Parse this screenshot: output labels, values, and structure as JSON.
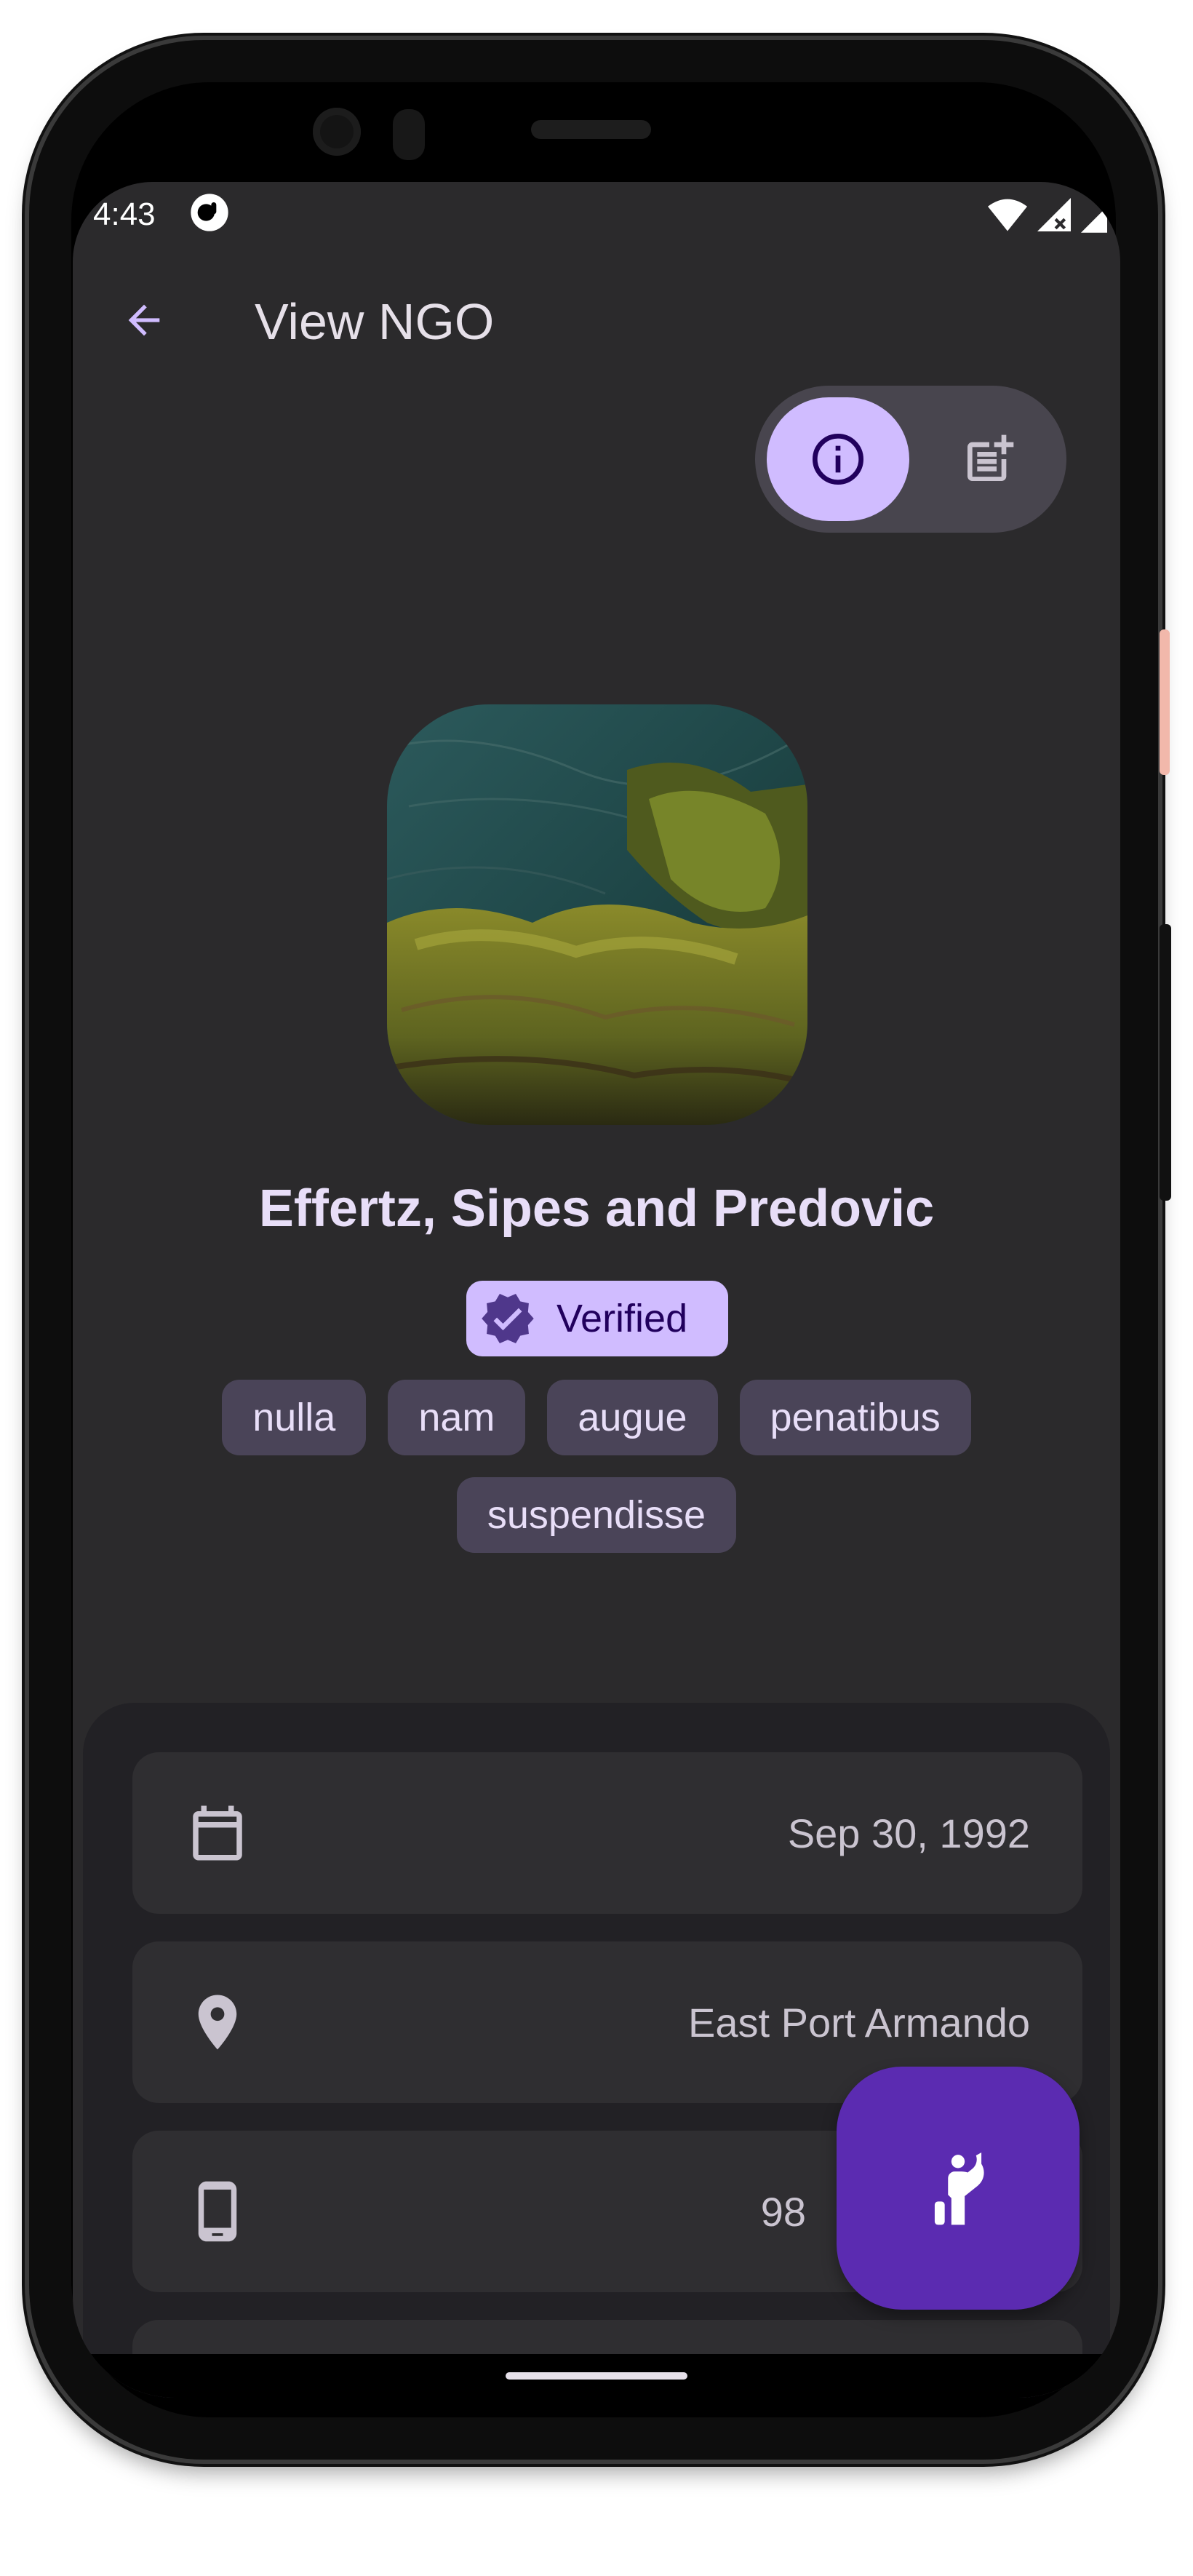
{
  "status_bar": {
    "time": "4:43"
  },
  "app_bar": {
    "title": "View NGO"
  },
  "segmented_control": {
    "options": [
      {
        "icon": "info-icon",
        "selected": true
      },
      {
        "icon": "post-add-icon",
        "selected": false
      }
    ]
  },
  "ngo": {
    "name": "Effertz, Sipes and Predovic",
    "verified_label": "Verified",
    "tags": [
      "nulla",
      "nam",
      "augue",
      "penatibus",
      "suspendisse"
    ]
  },
  "details": {
    "date": "Sep 30, 1992",
    "location": "East Port Armando",
    "phone": "98"
  },
  "fab": {
    "icon": "volunteer-icon"
  },
  "colors": {
    "background": "#2b2a2c",
    "primary": "#d0bcff",
    "fab": "#5b2bb1",
    "chip": "#4a4458",
    "card": "#2f2e31"
  }
}
